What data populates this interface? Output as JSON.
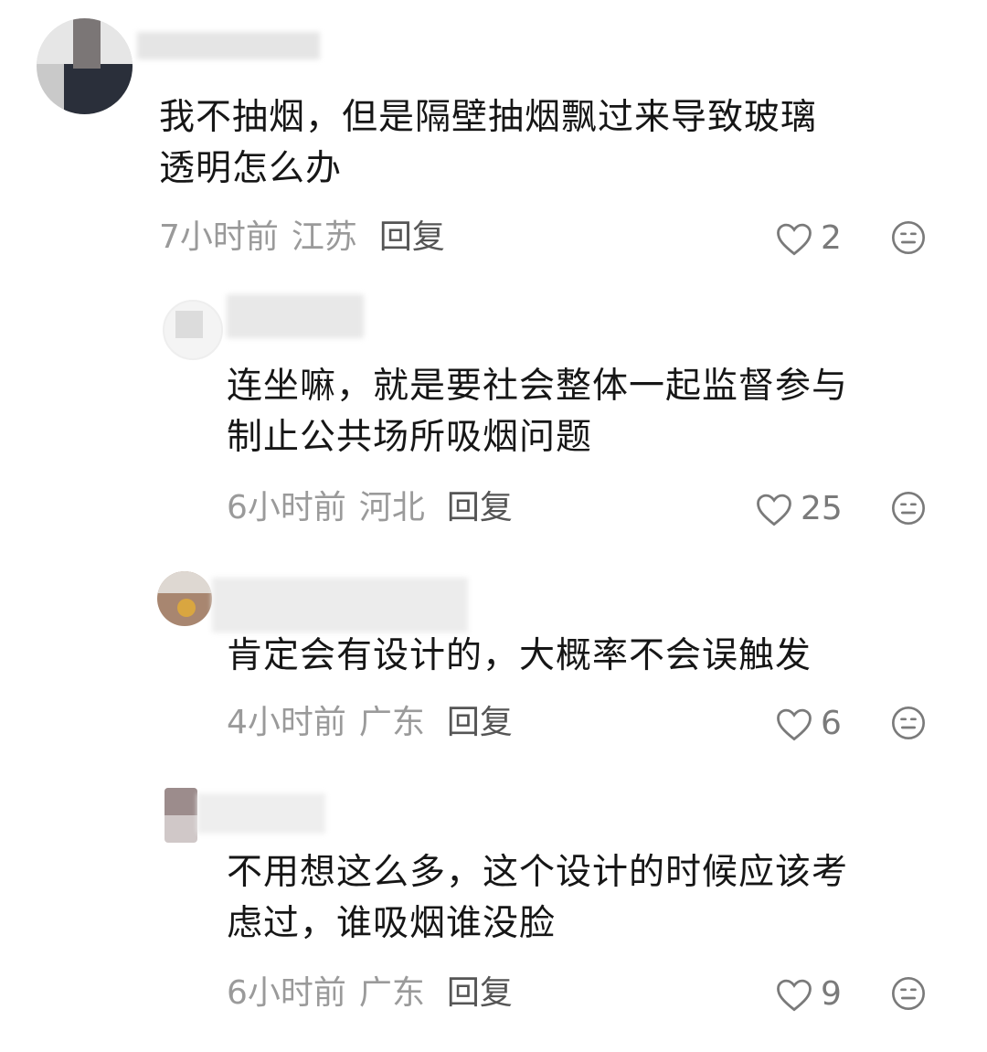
{
  "comments": [
    {
      "text_lines": [
        "我不抽烟，但是隔壁抽烟飘过来导致玻璃",
        "透明怎么办"
      ],
      "time": "7小时前",
      "region": "江苏",
      "reply_label": "回复",
      "likes": "2"
    },
    {
      "text_lines": [
        "连坐嘛，就是要社会整体一起监督参与",
        "制止公共场所吸烟问题"
      ],
      "time": "6小时前",
      "region": "河北",
      "reply_label": "回复",
      "likes": "25"
    },
    {
      "text_lines": [
        "肯定会有设计的，大概率不会误触发"
      ],
      "time": "4小时前",
      "region": "广东",
      "reply_label": "回复",
      "likes": "6"
    },
    {
      "text_lines": [
        "不用想这么多，这个设计的时候应该考",
        "虑过，谁吸烟谁没脸"
      ],
      "time": "6小时前",
      "region": "广东",
      "reply_label": "回复",
      "likes": "9"
    }
  ],
  "icons": {
    "like": "heart-outline-icon",
    "dislike": "neutral-face-icon"
  },
  "colors": {
    "text": "#161616",
    "meta": "#9a9a9a",
    "reply": "#555555"
  }
}
